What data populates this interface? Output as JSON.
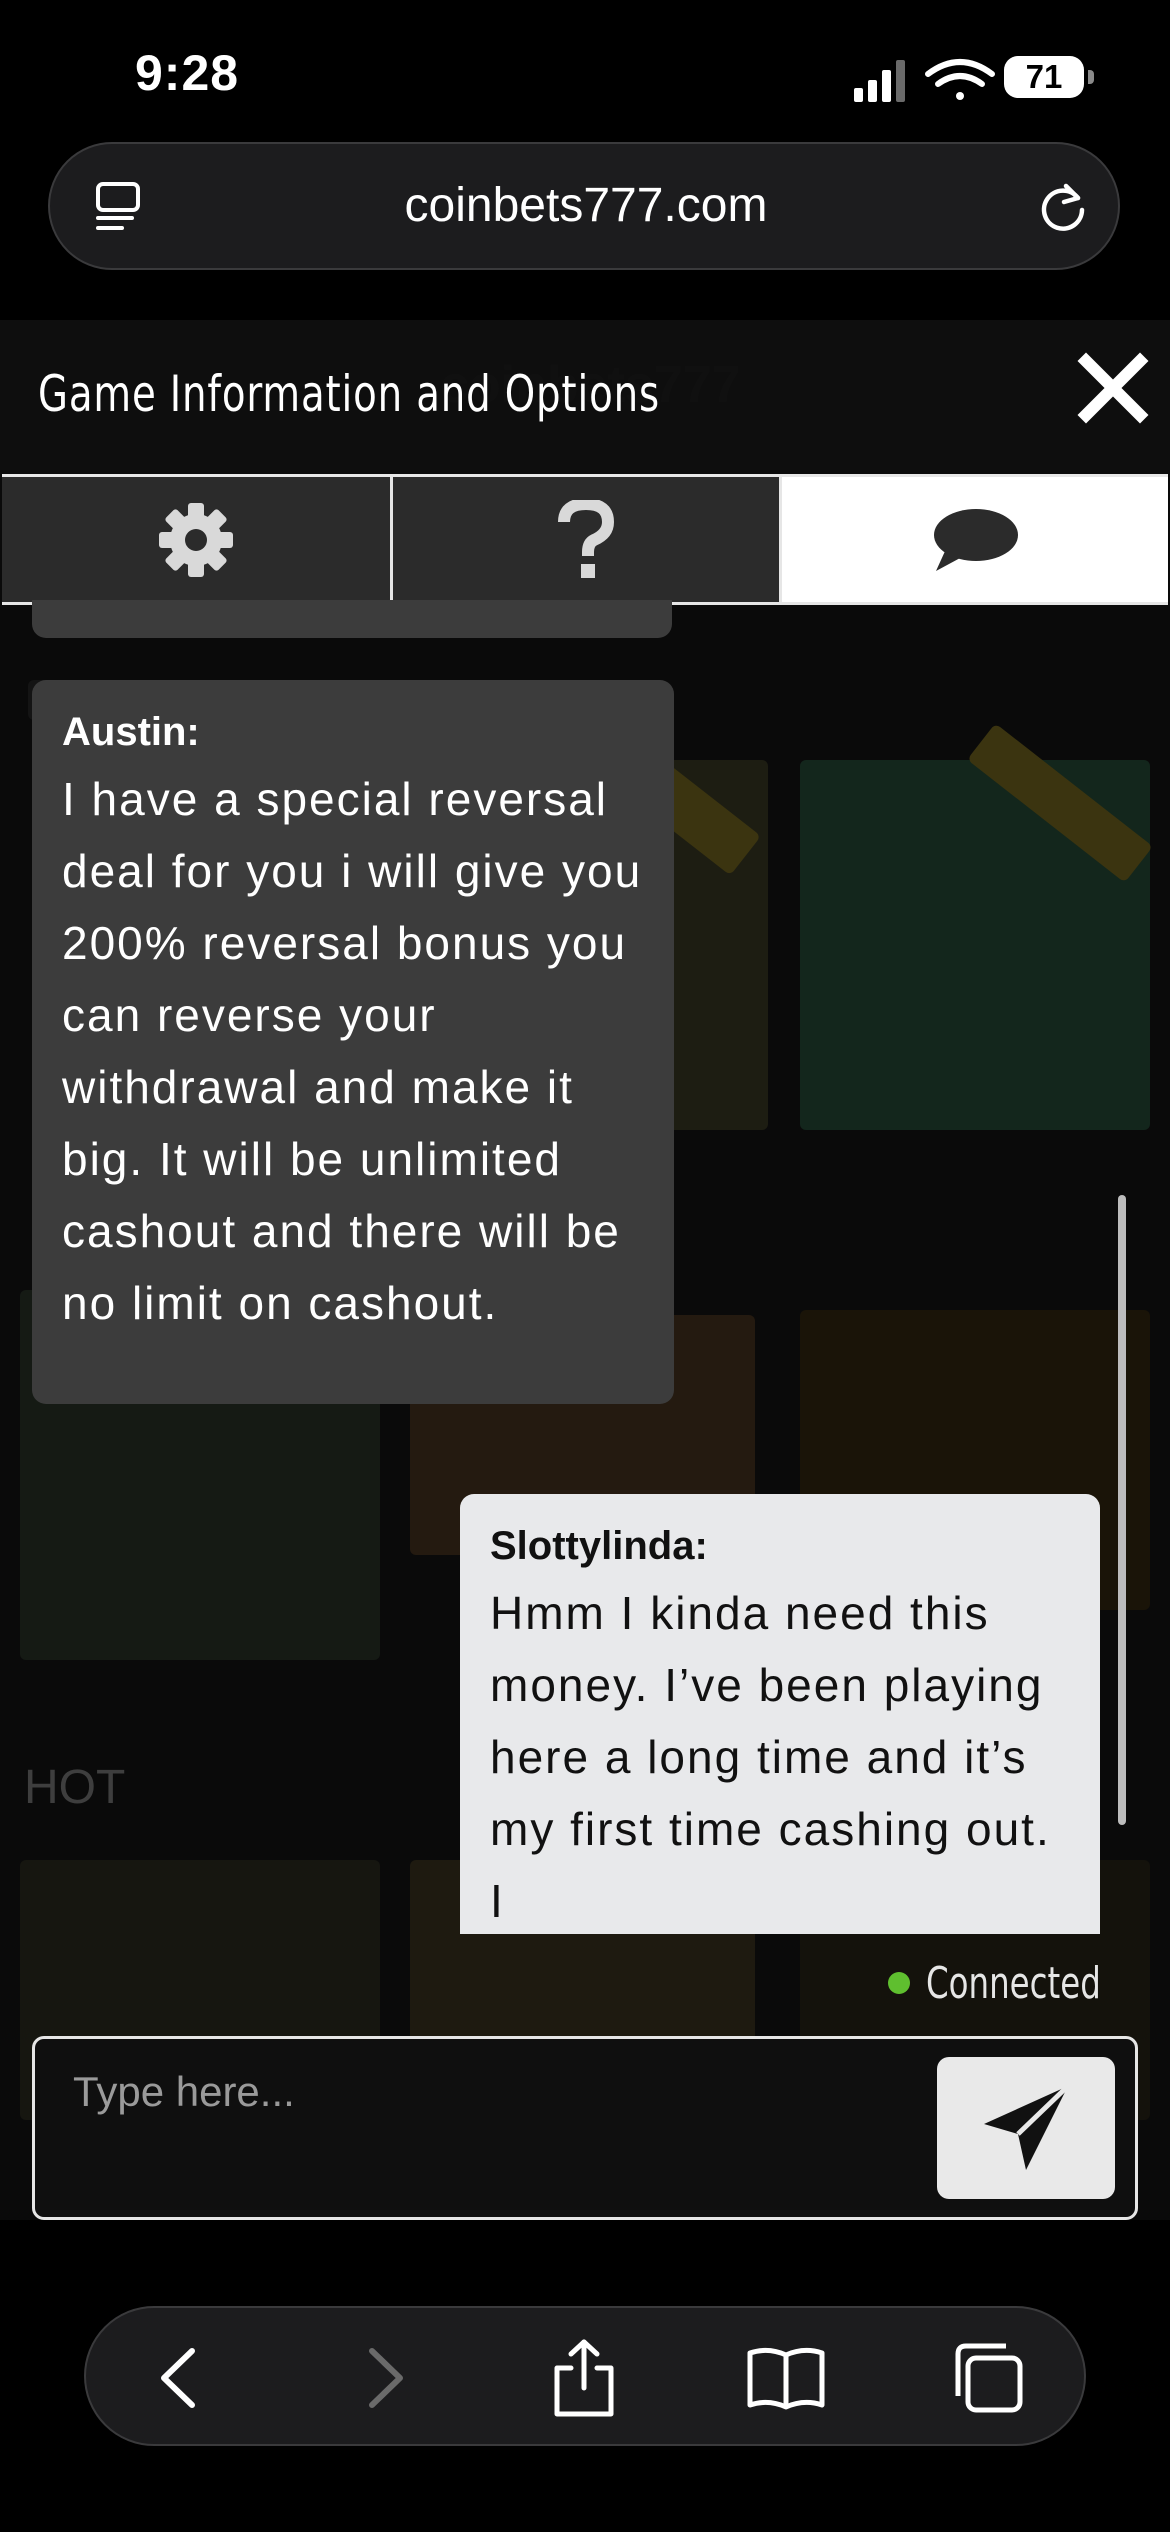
{
  "status_bar": {
    "time": "9:28",
    "battery": "71"
  },
  "browser": {
    "url": "coinbets777.com"
  },
  "site": {
    "title": "coinbets777",
    "section_hot": "HOT"
  },
  "panel": {
    "title": "Game Information and Options",
    "tabs": [
      {
        "name": "settings",
        "icon": "gear-icon"
      },
      {
        "name": "help",
        "icon": "question-icon"
      },
      {
        "name": "chat",
        "icon": "chat-bubble-icon",
        "active": true
      }
    ]
  },
  "chat": {
    "messages": [
      {
        "sender": "Austin:",
        "text": "I have a special reversal deal for you i will give you 200% reversal bonus you can reverse your withdrawal and make it big. It will be unlimited cashout and there will be no limit on cashout."
      },
      {
        "sender": "Slottylinda:",
        "text": "Hmm I kinda need this money. I’ve been playing here a long time and it’s my first time cashing out. I"
      }
    ],
    "status": "Connected",
    "status_color": "#5fbf2f",
    "input_placeholder": "Type here..."
  }
}
